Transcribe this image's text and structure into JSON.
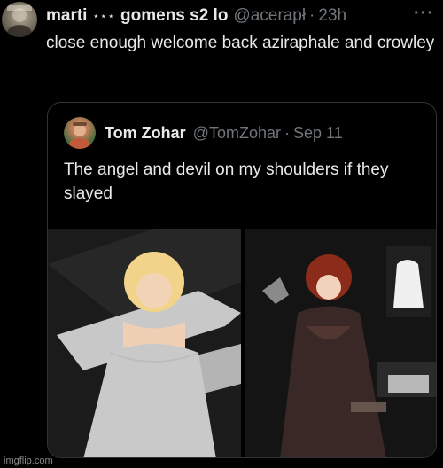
{
  "tweet": {
    "avatar_icon": "user-avatar-icon",
    "display_name": "marti",
    "name_decoration": "⋆⋆⋆",
    "name_suffix": "gomens s2 lo",
    "handle": "@acerapł",
    "separator": "·",
    "time": "23h",
    "more": "···",
    "text": "close enough welcome back aziraphale and crowley"
  },
  "quote": {
    "avatar_icon": "user-avatar-icon",
    "display_name": "Tom Zohar",
    "handle": "@TomZohar",
    "separator": "·",
    "date": "Sep 11",
    "text": "The angel and devil on my shoulders if they slayed",
    "media": [
      {
        "name": "photo-left",
        "desc_icon": "photo-icon"
      },
      {
        "name": "photo-right",
        "desc_icon": "photo-icon"
      }
    ]
  },
  "watermark": "imgflip.com",
  "colors": {
    "background": "#000000",
    "text": "#e7e9ea",
    "muted": "#71767b",
    "border": "#2f3336"
  }
}
